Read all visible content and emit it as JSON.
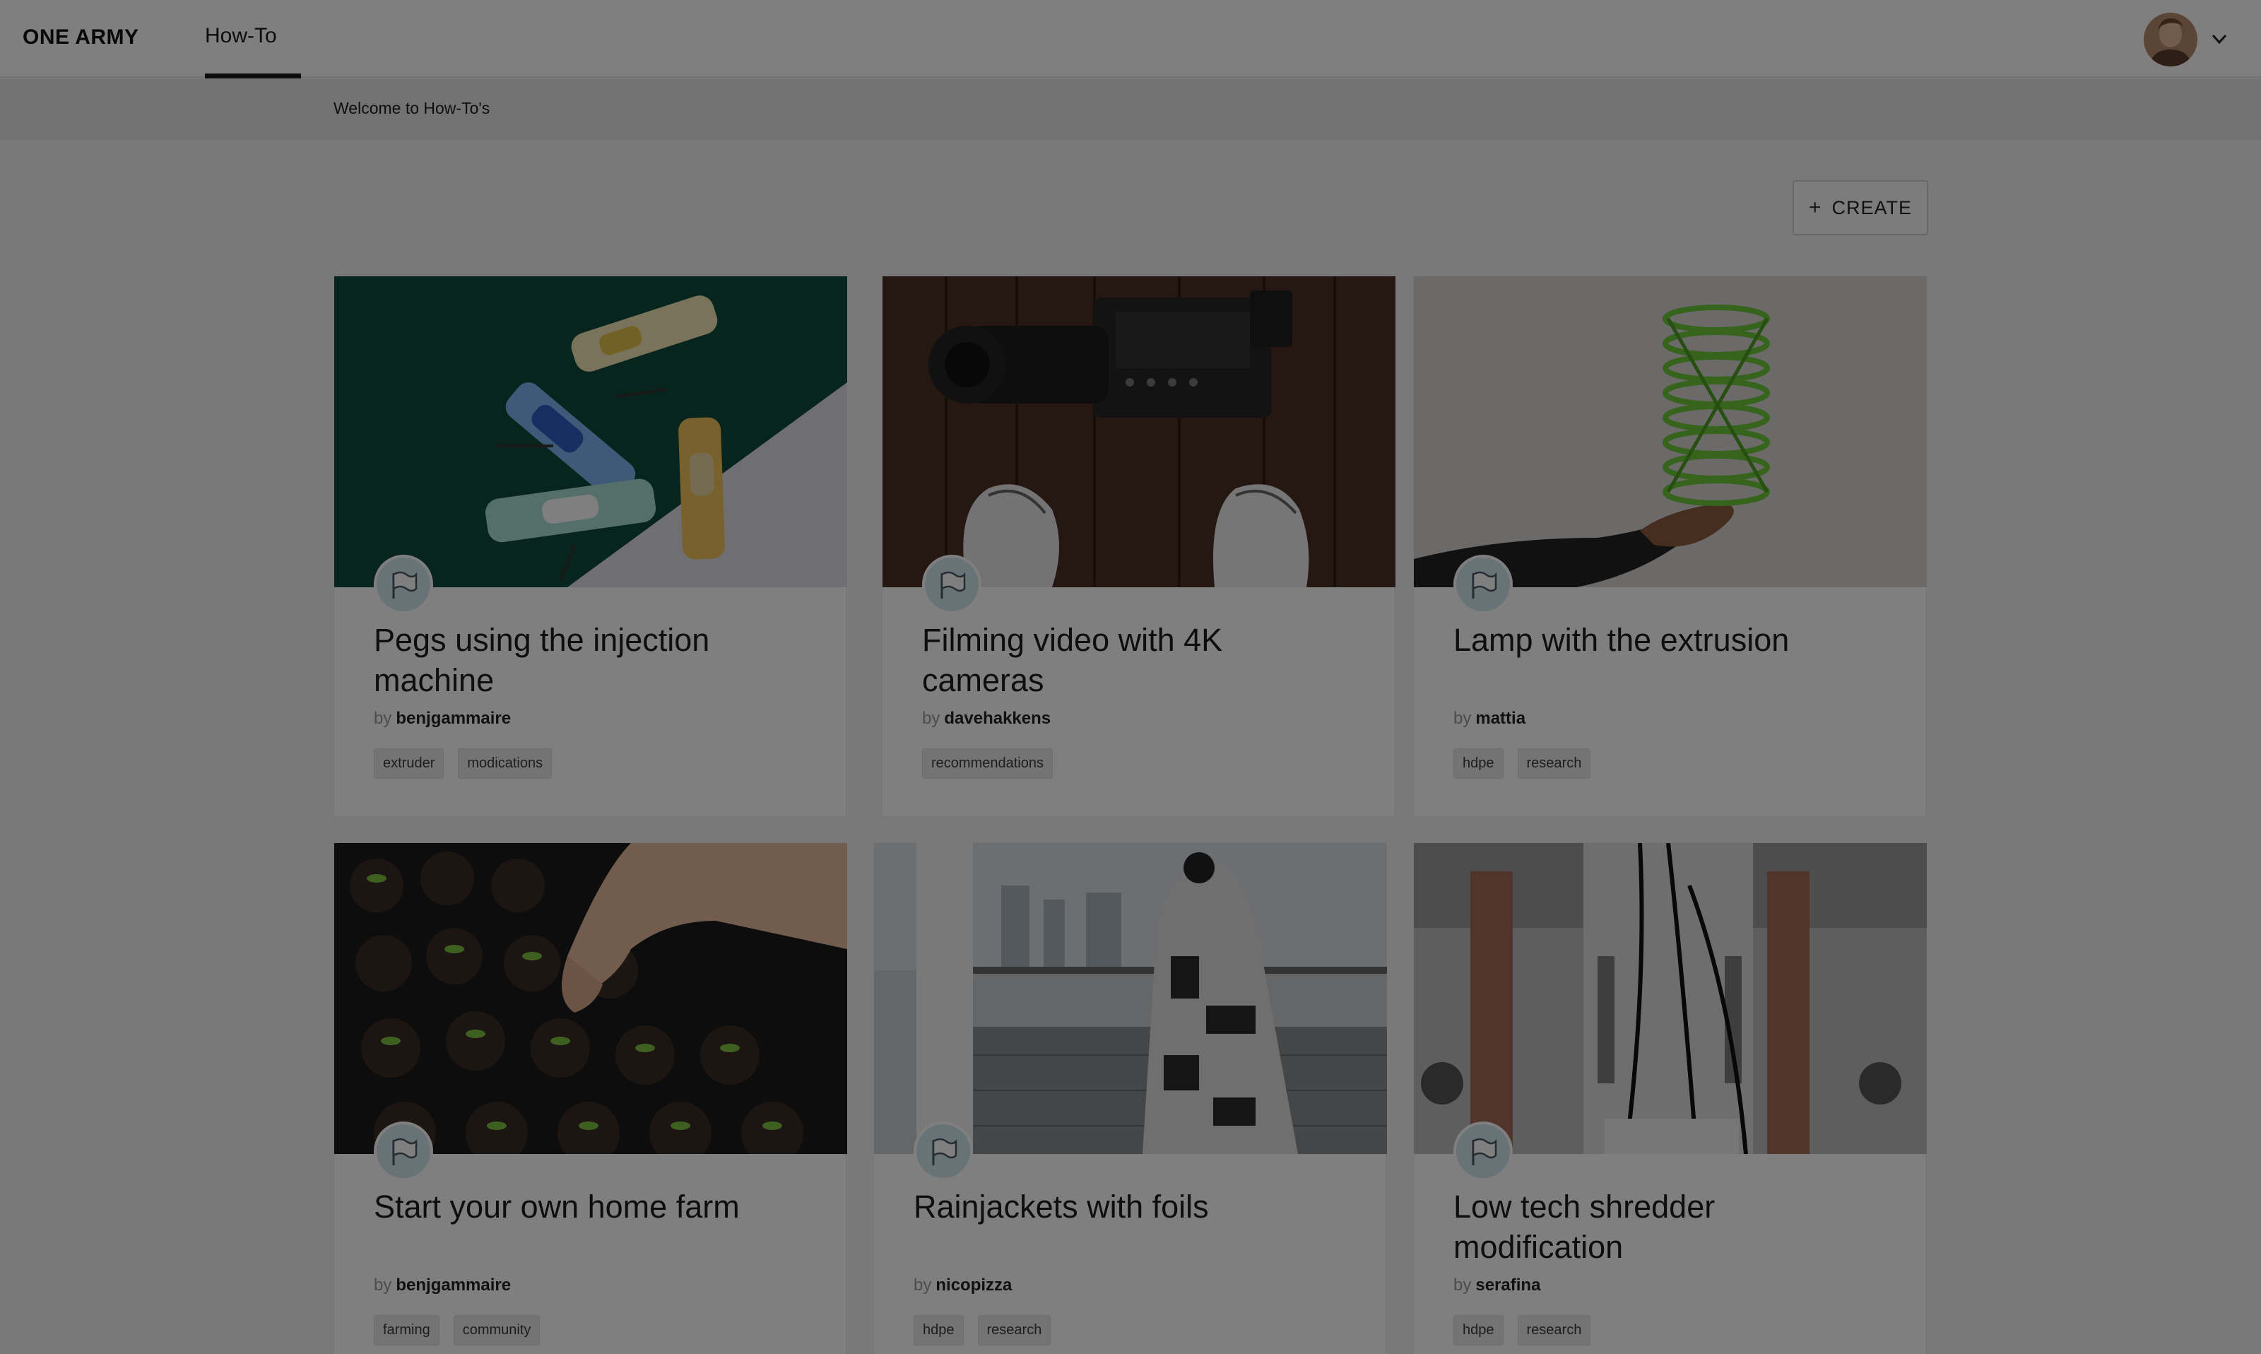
{
  "header": {
    "logo": "ONE ARMY",
    "tabs": [
      {
        "label": "How-To",
        "active": true
      }
    ],
    "avatar_icon": "user-avatar",
    "menu_icon": "chevron-down-icon"
  },
  "subbar": {
    "text": "Welcome to How-To's"
  },
  "toolbar": {
    "create_label": "CREATE",
    "create_icon": "plus-icon"
  },
  "howtos": [
    {
      "title": "Pegs using the injection machine",
      "by": "by",
      "author": "benjgammaire",
      "tags": [
        "extruder",
        "modications"
      ],
      "image": "colorful plastic pegs on green and white background"
    },
    {
      "title": "Filming video with 4K cameras",
      "by": "by",
      "author": "davehakkens",
      "tags": [
        "recommendations"
      ],
      "image": "4K camera on wooden floor with sneakers"
    },
    {
      "title": "Lamp with the extrusion",
      "by": "by",
      "author": "mattia",
      "tags": [
        "hdpe",
        "research"
      ],
      "image": "hand holding green spiral lamp"
    },
    {
      "title": "Start your own home farm",
      "by": "by",
      "author": "benjgammaire",
      "tags": [
        "farming",
        "community"
      ],
      "image": "hand planting seedlings in tray"
    },
    {
      "title": "Rainjackets with foils",
      "by": "by",
      "author": "nicopizza",
      "tags": [
        "hdpe",
        "research"
      ],
      "image": "child in printed raincoat on rooftop"
    },
    {
      "title": "Low tech shredder modification",
      "by": "by",
      "author": "serafina",
      "tags": [
        "hdpe",
        "research"
      ],
      "image": "machine parts close-up"
    }
  ],
  "colors": {
    "page_bg": "#f3f3f3",
    "header_bg": "#ffffff",
    "subbar_bg": "#e7e7e7",
    "tag_bg": "#e9e9e9",
    "badge_bg": "#cfe6ef",
    "overlay": "rgba(0,0,0,0.5)"
  }
}
